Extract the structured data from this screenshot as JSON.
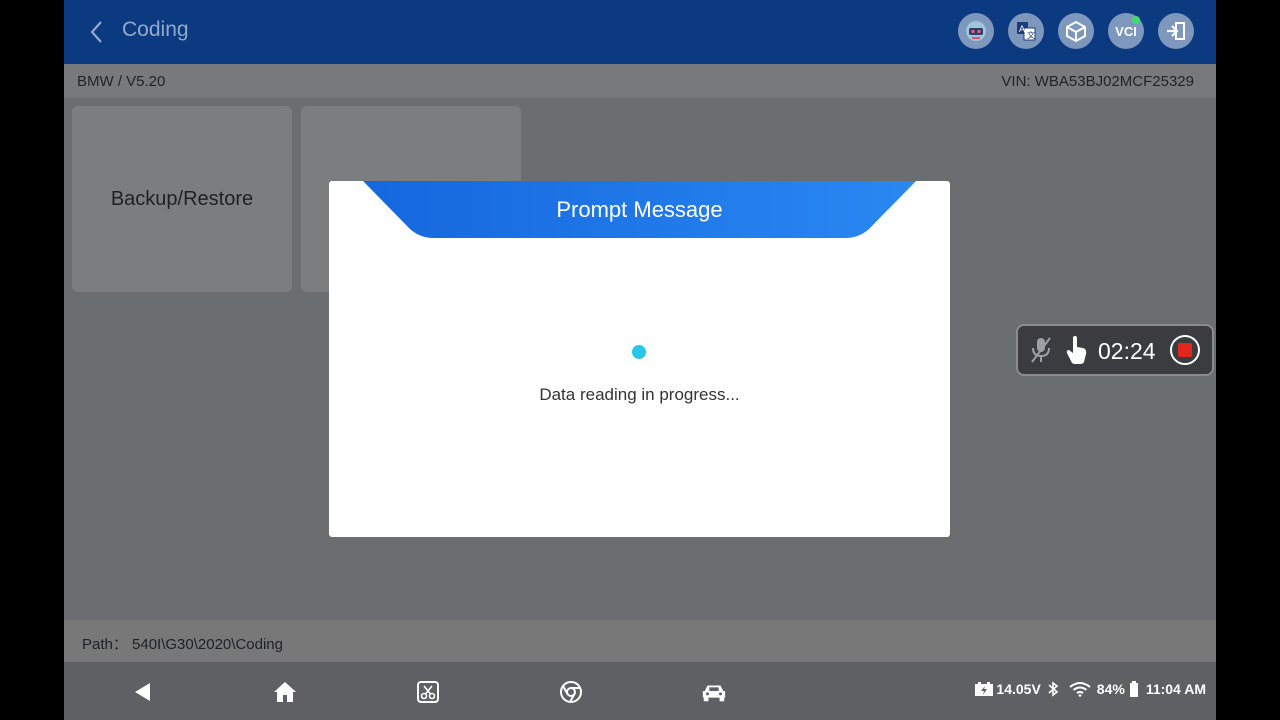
{
  "header": {
    "title": "Coding",
    "icons": [
      "robot-icon",
      "translate-icon",
      "box-icon",
      "vci-icon",
      "exit-icon"
    ],
    "vci_label": "VCI"
  },
  "subbar": {
    "vehicle": "BMW / V5.20",
    "vin": "VIN: WBA53BJ02MCF25329"
  },
  "tiles": [
    {
      "label": "Backup/Restore"
    },
    {
      "label": ""
    }
  ],
  "dialog": {
    "title": "Prompt Message",
    "message": "Data reading in progress..."
  },
  "recorder": {
    "time": "02:24"
  },
  "path": {
    "text": "Path： 540I\\G30\\2020\\Coding"
  },
  "navbar": {
    "icons": [
      "back-triangle-icon",
      "home-icon",
      "screenshot-icon",
      "chrome-icon",
      "car-icon"
    ]
  },
  "status": {
    "voltage": "14.05V",
    "battery": "84%",
    "time": "11:04 AM"
  },
  "colors": {
    "topbar": "#0c3a80",
    "dialog_header": "#1e78e6",
    "spinner": "#27c7ea"
  }
}
